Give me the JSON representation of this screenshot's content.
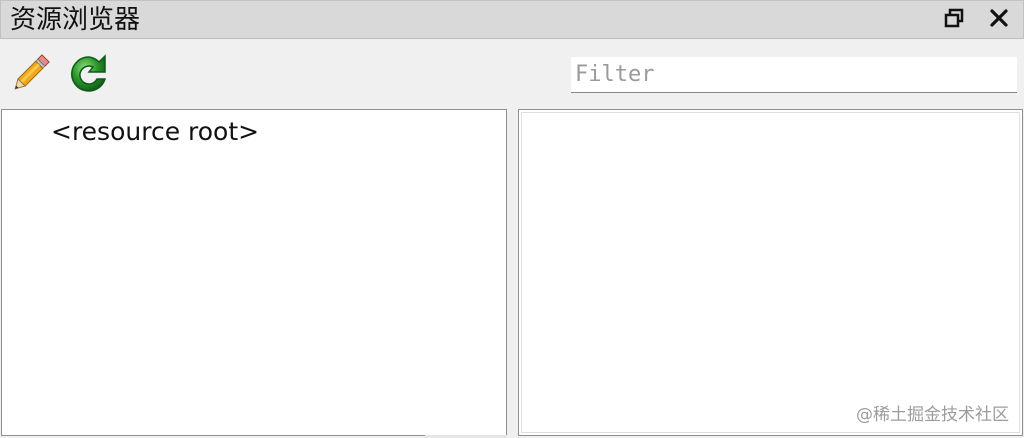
{
  "window": {
    "title": "资源浏览器",
    "restore_icon": "restore-window-icon",
    "close_icon": "close-icon"
  },
  "toolbar": {
    "edit_icon": "pencil-icon",
    "refresh_icon": "refresh-icon",
    "filter_placeholder": "Filter",
    "filter_value": ""
  },
  "tree": {
    "items": [
      {
        "label": "<resource root>"
      }
    ]
  },
  "preview": {
    "watermark": "@稀土掘金技术社区"
  },
  "colors": {
    "titlebar_bg": "#d9d9d9",
    "panel_bg": "#f0f0f0",
    "content_bg": "#ffffff",
    "pencil_yellow": "#f0a81a",
    "refresh_green": "#2e9a2a"
  }
}
